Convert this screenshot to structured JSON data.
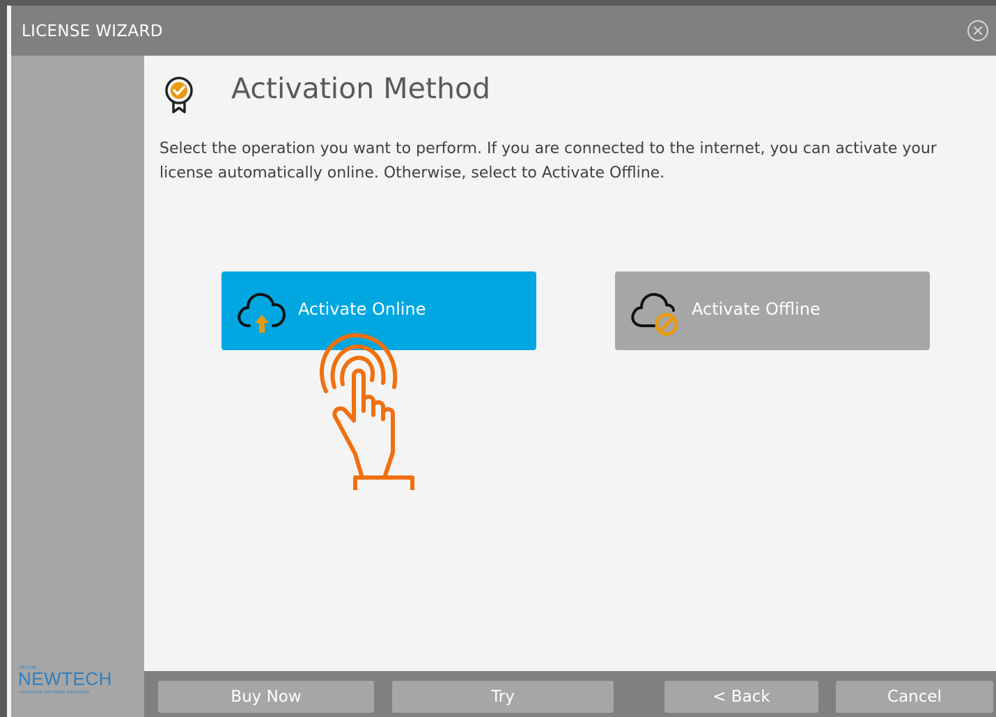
{
  "window": {
    "title": "LICENSE WIZARD",
    "close_icon": "close-circle-icon"
  },
  "sidebar": {
    "brand": {
      "top_text": "SPLIHN",
      "name": "NEWTECH",
      "tagline": "LIFESAVING SOFTWARE SOLUTIONS"
    }
  },
  "main": {
    "heading_icon": "award-badge-check-icon",
    "heading": "Activation Method",
    "description": "Select the operation you want to perform. If you are connected to the internet, you can activate your license automatically online. Otherwise, select to Activate Offline.",
    "options": [
      {
        "label": "Activate Online",
        "icon": "cloud-upload-icon",
        "color": "#00a7e1",
        "selected": true
      },
      {
        "label": "Activate Offline",
        "icon": "cloud-blocked-icon",
        "color": "#a6a6a6",
        "selected": false
      }
    ],
    "pointer_icon": "tap-hand-icon"
  },
  "footer": {
    "buttons": [
      "Buy Now",
      "Try",
      "< Back",
      "Cancel"
    ]
  },
  "colors": {
    "accent": "#00a7e1",
    "orange": "#f0700f",
    "gold": "#e89a10",
    "titlebar": "#808080",
    "sidebar": "#a6a6a6"
  }
}
